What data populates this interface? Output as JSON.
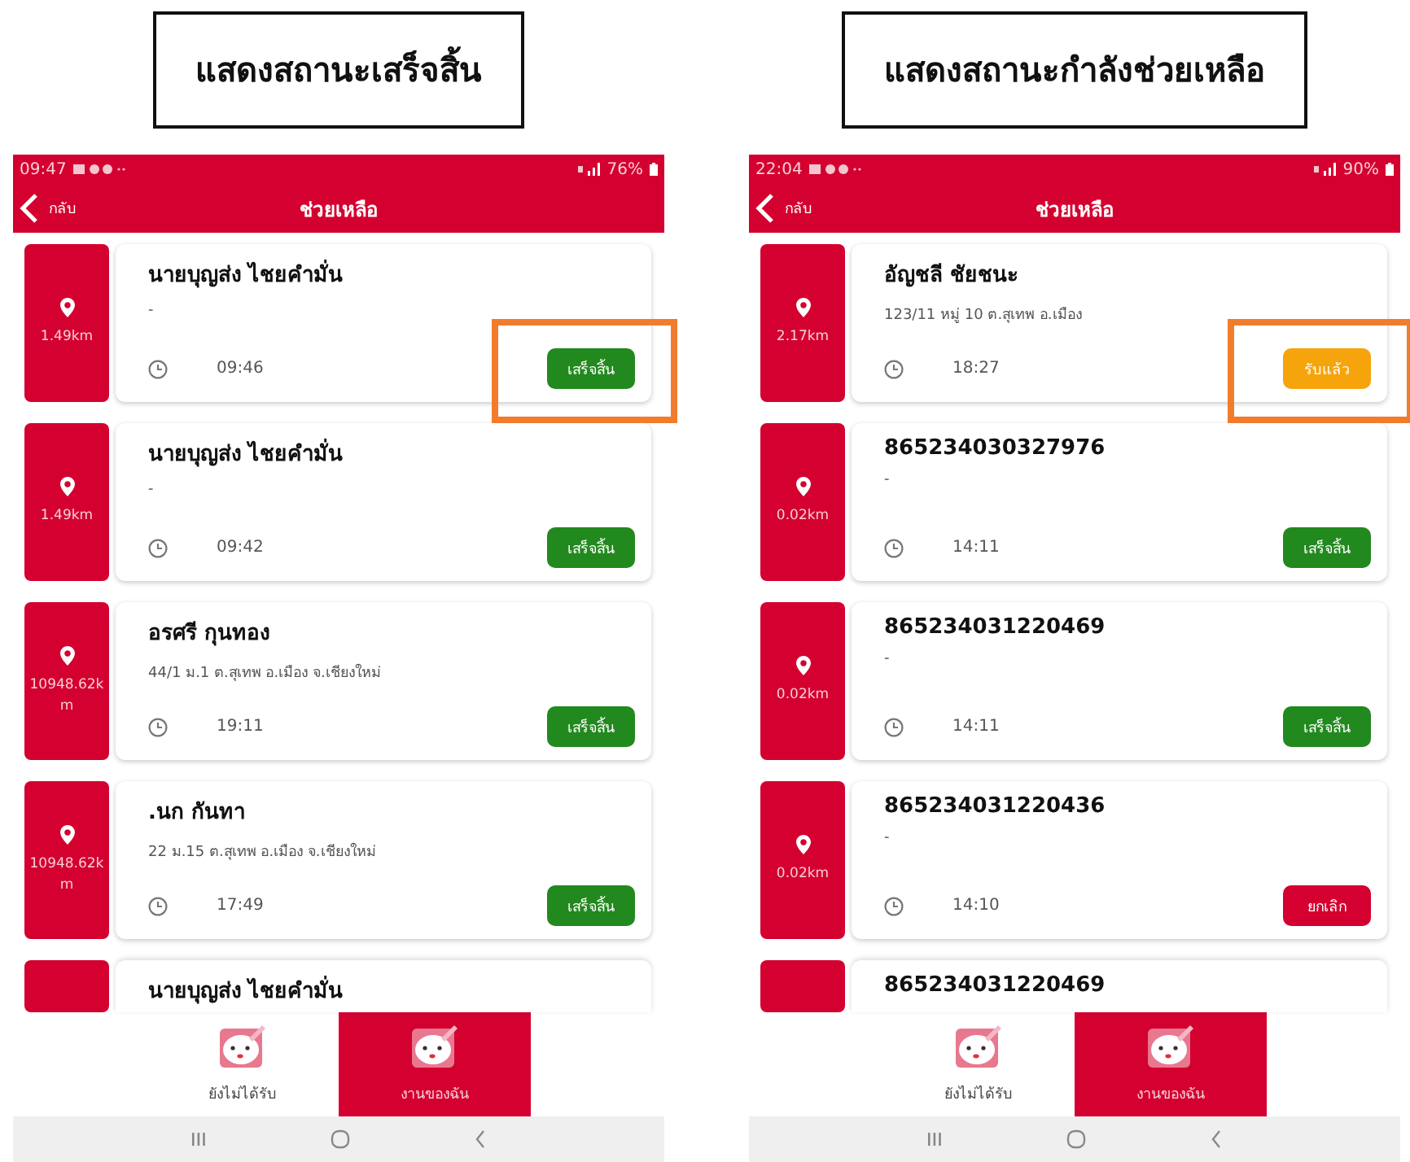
{
  "panels": [
    {
      "caption": "แสดงสถานะเสร็จสิ้น",
      "status_bar": {
        "time": "09:47",
        "battery": "76%"
      },
      "header": {
        "back": "กลับ",
        "title": "ช่วยเหลือ"
      },
      "cards": [
        {
          "distance": "1.49km",
          "name": "นายบุญส่ง ไชยคำมั่น",
          "detail": "-",
          "time": "09:46",
          "button": {
            "kind": "done",
            "label": "เสร็จสิ้น"
          },
          "highlighted": true
        },
        {
          "distance": "1.49km",
          "name": "นายบุญส่ง ไชยคำมั่น",
          "detail": "-",
          "time": "09:42",
          "button": {
            "kind": "done",
            "label": "เสร็จสิ้น"
          },
          "highlighted": false
        },
        {
          "distance": "10948.62km",
          "name": "อรศรี กุนทอง",
          "detail": "44/1 ม.1 ต.สุเทพ อ.เมือง จ.เชียงใหม่",
          "time": "19:11",
          "button": {
            "kind": "done",
            "label": "เสร็จสิ้น"
          },
          "highlighted": false
        },
        {
          "distance": "10948.62km",
          "name": ".นก กันทา",
          "detail": "22 ม.15 ต.สุเทพ อ.เมือง จ.เชียงใหม่",
          "time": "17:49",
          "button": {
            "kind": "done",
            "label": "เสร็จสิ้น"
          },
          "highlighted": false
        },
        {
          "name": "นายบุญส่ง ไชยคำมั่น"
        }
      ],
      "tabs": [
        {
          "label": "ยังไม่ได้รับ",
          "selected": false
        },
        {
          "label": "งานของฉัน",
          "selected": true
        }
      ]
    },
    {
      "caption": "แสดงสถานะกำลังช่วยเหลือ",
      "status_bar": {
        "time": "22:04",
        "battery": "90%"
      },
      "header": {
        "back": "กลับ",
        "title": "ช่วยเหลือ"
      },
      "cards": [
        {
          "distance": "2.17km",
          "name": "อัญชลี ชัยชนะ",
          "detail": "123/11 หมู่ 10 ต.สุเทพ อ.เมือง",
          "time": "18:27",
          "button": {
            "kind": "accepted",
            "label": "รับแล้ว"
          },
          "highlighted": true
        },
        {
          "distance": "0.02km",
          "name": "865234030327976",
          "detail": "-",
          "time": "14:11",
          "button": {
            "kind": "done",
            "label": "เสร็จสิ้น"
          },
          "highlighted": false
        },
        {
          "distance": "0.02km",
          "name": "865234031220469",
          "detail": "-",
          "time": "14:11",
          "button": {
            "kind": "done",
            "label": "เสร็จสิ้น"
          },
          "highlighted": false
        },
        {
          "distance": "0.02km",
          "name": "865234031220436",
          "detail": "-",
          "time": "14:10",
          "button": {
            "kind": "cancel",
            "label": "ยกเลิก"
          },
          "highlighted": false
        },
        {
          "name": "865234031220469"
        }
      ],
      "tabs": [
        {
          "label": "ยังไม่ได้รับ",
          "selected": false
        },
        {
          "label": "งานของฉัน",
          "selected": true
        }
      ]
    }
  ]
}
